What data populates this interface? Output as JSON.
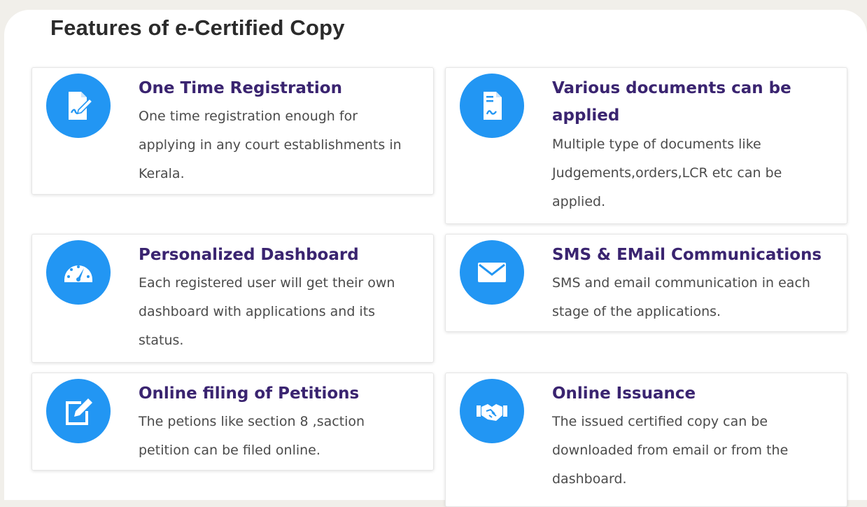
{
  "section": {
    "heading": "Features of e-Certified Copy"
  },
  "features": [
    {
      "title": "One Time Registration",
      "description": "One time registration enough for applying in any court establishments in Kerala.",
      "icon": "signed-document-icon"
    },
    {
      "title": "Various documents can be applied",
      "description": "Multiple type of documents like Judgements,orders,LCR etc can be applied.",
      "icon": "document-icon"
    },
    {
      "title": "Personalized Dashboard",
      "description": "Each registered user will get their own dashboard with applications and its status.",
      "icon": "dashboard-gauge-icon"
    },
    {
      "title": "SMS & EMail Communications",
      "description": "SMS and email communication in each stage of the applications.",
      "icon": "envelope-icon"
    },
    {
      "title": "Online filing of Petitions",
      "description": "The petions like section 8 ,saction petition can be filed online.",
      "icon": "edit-icon"
    },
    {
      "title": "Online Issuance",
      "description": "The issued certified copy can be downloaded from email or from the dashboard.",
      "icon": "handshake-icon"
    }
  ],
  "colors": {
    "icon_background": "#2296f3",
    "title_text": "#3a2470",
    "body_text": "#4b4b4b"
  }
}
